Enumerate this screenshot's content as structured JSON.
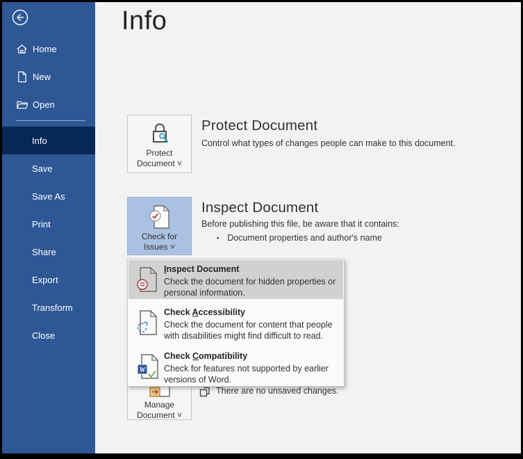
{
  "page": {
    "title": "Info"
  },
  "glyphs": {
    "chevron": "˅",
    "list_bullet": "▪"
  },
  "sidebar": {
    "top_items": [
      {
        "label": "Home"
      },
      {
        "label": "New"
      },
      {
        "label": "Open"
      }
    ],
    "menu_items": [
      {
        "label": "Info"
      },
      {
        "label": "Save"
      },
      {
        "label": "Save As"
      },
      {
        "label": "Print"
      },
      {
        "label": "Share"
      },
      {
        "label": "Export"
      },
      {
        "label": "Transform"
      },
      {
        "label": "Close"
      }
    ]
  },
  "sections": {
    "protect": {
      "button_line1": "Protect",
      "button_line2": "Document",
      "heading": "Protect Document",
      "description": "Control what types of changes people can make to this document."
    },
    "inspect": {
      "button_line1": "Check for",
      "button_line2": "Issues",
      "heading": "Inspect Document",
      "description": "Before publishing this file, be aware that it contains:",
      "bullet": "Document properties and author's name"
    },
    "manage": {
      "button_line1": "Manage",
      "button_line2": "Document",
      "status": "There are no unsaved changes."
    }
  },
  "menu": {
    "items": [
      {
        "title_pre": "",
        "title_key": "I",
        "title_post": "nspect Document",
        "description": "Check the document for hidden properties or personal information."
      },
      {
        "title_pre": "Check ",
        "title_key": "A",
        "title_post": "ccessibility",
        "description": "Check the document for content that people with disabilities might find difficult to read."
      },
      {
        "title_pre": "Check ",
        "title_key": "C",
        "title_post": "ompatibility",
        "description": "Check for features not supported by earlier versions of Word."
      }
    ]
  },
  "colors": {
    "sidebar_blue": "#2e5795",
    "sidebar_selected": "#072757",
    "main_bg": "#f2f2f2",
    "issues_button_highlight": "#aac1e2",
    "menu_hover": "#d3d1d0",
    "word_blue": "#2b579a",
    "key_blue": "#2f9ad0",
    "check_red": "#c0392b",
    "check_green": "#70ad47"
  }
}
